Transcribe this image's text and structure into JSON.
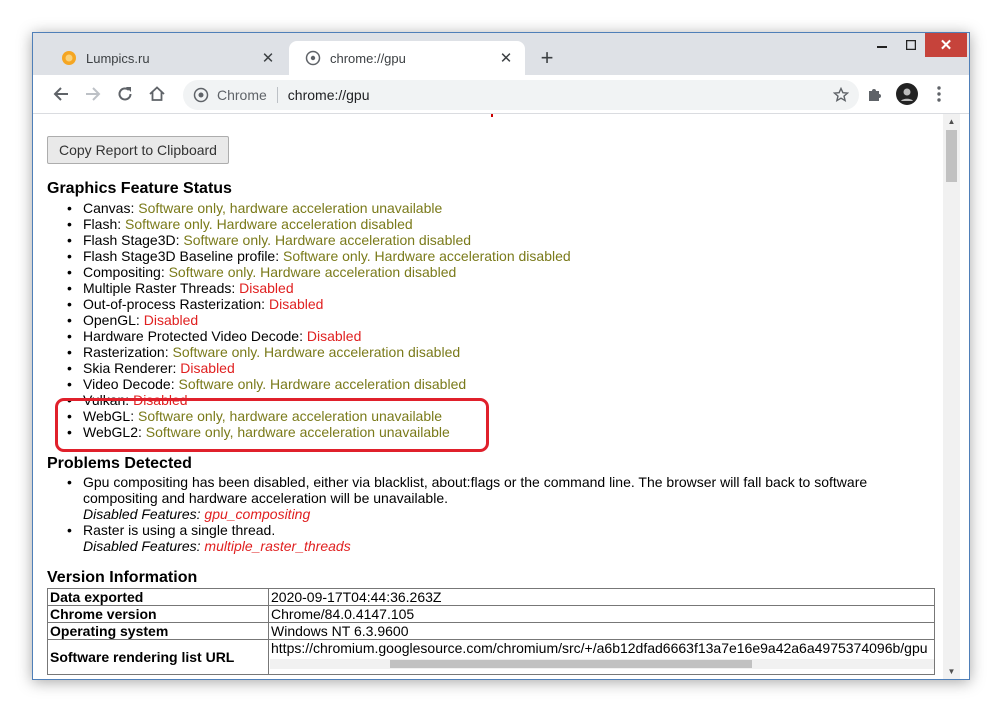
{
  "tabs": [
    {
      "title": "Lumpics.ru",
      "favicon": "lumpics-favicon-icon",
      "active": false
    },
    {
      "title": "chrome://gpu",
      "favicon": "globe-icon",
      "active": true
    }
  ],
  "toolbar": {
    "site_label": "Chrome",
    "url": "chrome://gpu"
  },
  "page": {
    "copy_button_label": "Copy Report to Clipboard",
    "feature_status_title": "Graphics Feature Status",
    "features": [
      {
        "name": "Canvas:",
        "status": "Software only, hardware acceleration unavailable",
        "kind": "ok"
      },
      {
        "name": "Flash:",
        "status": "Software only. Hardware acceleration disabled",
        "kind": "ok"
      },
      {
        "name": "Flash Stage3D:",
        "status": "Software only. Hardware acceleration disabled",
        "kind": "ok"
      },
      {
        "name": "Flash Stage3D Baseline profile:",
        "status": "Software only. Hardware acceleration disabled",
        "kind": "ok"
      },
      {
        "name": "Compositing:",
        "status": "Software only. Hardware acceleration disabled",
        "kind": "ok"
      },
      {
        "name": "Multiple Raster Threads:",
        "status": "Disabled",
        "kind": "bad"
      },
      {
        "name": "Out-of-process Rasterization:",
        "status": "Disabled",
        "kind": "bad"
      },
      {
        "name": "OpenGL:",
        "status": "Disabled",
        "kind": "bad"
      },
      {
        "name": "Hardware Protected Video Decode:",
        "status": "Disabled",
        "kind": "bad"
      },
      {
        "name": "Rasterization:",
        "status": "Software only. Hardware acceleration disabled",
        "kind": "ok"
      },
      {
        "name": "Skia Renderer:",
        "status": "Disabled",
        "kind": "bad"
      },
      {
        "name": "Video Decode:",
        "status": "Software only. Hardware acceleration disabled",
        "kind": "ok"
      },
      {
        "name": "Vulkan:",
        "status": "Disabled",
        "kind": "bad"
      },
      {
        "name": "WebGL:",
        "status": "Software only, hardware acceleration unavailable",
        "kind": "ok"
      },
      {
        "name": "WebGL2:",
        "status": "Software only, hardware acceleration unavailable",
        "kind": "ok"
      }
    ],
    "problems_title": "Problems Detected",
    "problems": [
      {
        "text": "Gpu compositing has been disabled, either via blacklist, about:flags or the command line. The browser will fall back to software compositing and hardware acceleration will be unavailable.",
        "disabled_label": "Disabled Features:",
        "disabled_value": "gpu_compositing"
      },
      {
        "text": "Raster is using a single thread.",
        "disabled_label": "Disabled Features:",
        "disabled_value": "multiple_raster_threads"
      }
    ],
    "version_title": "Version Information",
    "version_rows": [
      {
        "key": "Data exported",
        "value": "2020-09-17T04:44:36.263Z"
      },
      {
        "key": "Chrome version",
        "value": "Chrome/84.0.4147.105"
      },
      {
        "key": "Operating system",
        "value": "Windows NT 6.3.9600"
      },
      {
        "key": "Software rendering list URL",
        "value": "https://chromium.googlesource.com/chromium/src/+/a6b12dfad6663f13a7e16e9a42a6a4975374096b/gpu"
      }
    ]
  },
  "colors": {
    "ok_status": "#7a7a1a",
    "bad_status": "#e02020",
    "highlight": "#e0202b",
    "close_button": "#c6433b"
  }
}
